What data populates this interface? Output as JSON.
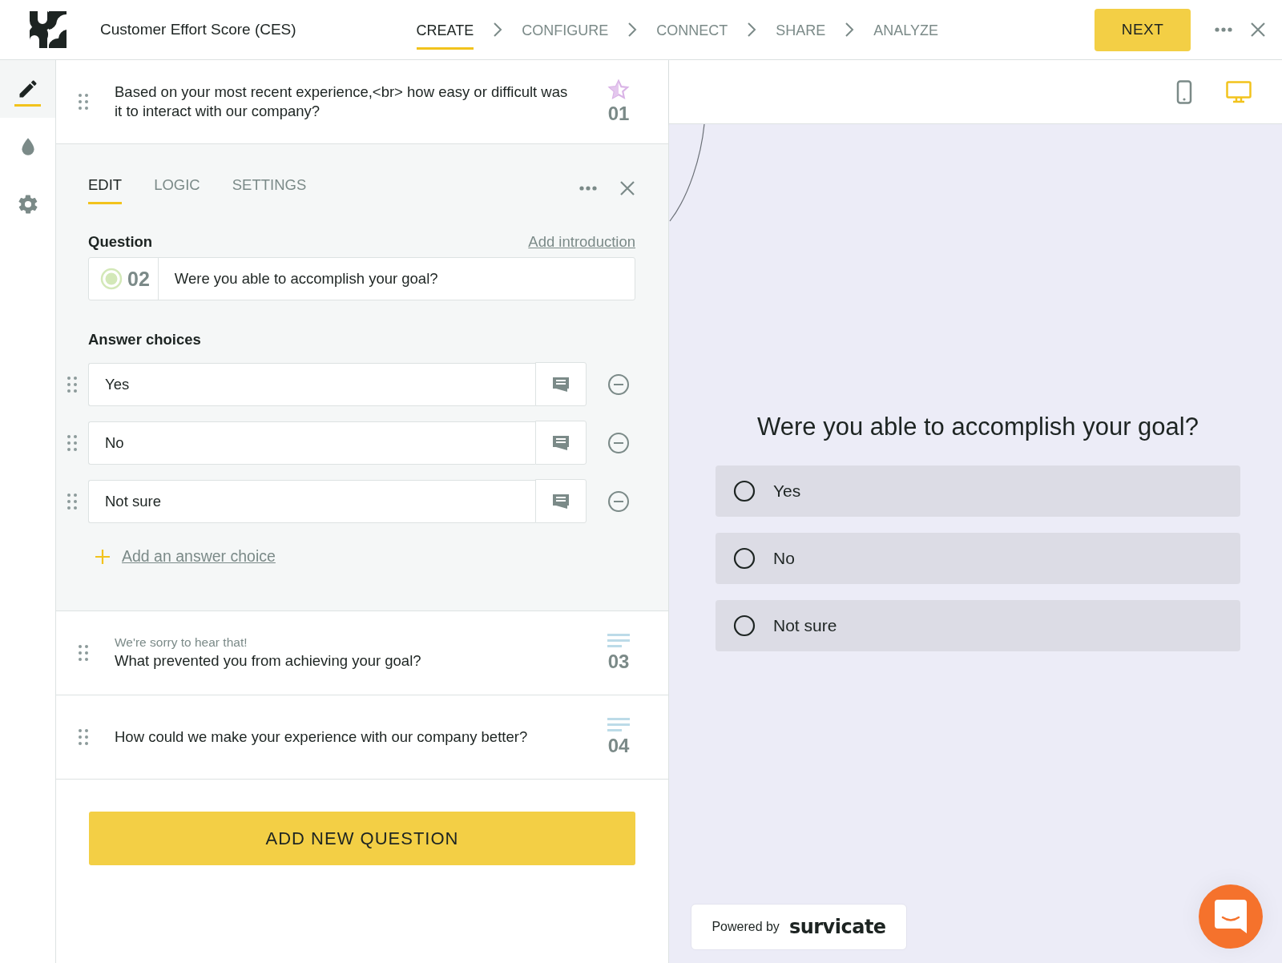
{
  "header": {
    "survey_title": "Customer Effort Score (CES)",
    "steps": [
      {
        "label": "CREATE",
        "selected": true
      },
      {
        "label": "CONFIGURE",
        "selected": false
      },
      {
        "label": "CONNECT",
        "selected": false
      },
      {
        "label": "SHARE",
        "selected": false
      },
      {
        "label": "ANALYZE",
        "selected": false
      }
    ],
    "next_button": "NEXT"
  },
  "sidebar": {
    "items": [
      {
        "kind": "design",
        "selected": true
      },
      {
        "kind": "theme",
        "selected": false
      },
      {
        "kind": "settings",
        "selected": false
      }
    ]
  },
  "questions": [
    {
      "kind": "rating",
      "number": "01",
      "text": "Based on your most recent experience,<br> how easy or difficult was it to interact with our company?",
      "expanded": false
    },
    {
      "kind": "single_choice",
      "number": "02",
      "text": "Were you able to accomplish your goal?",
      "expanded": true
    },
    {
      "kind": "text",
      "number": "03",
      "intro": "We're sorry to hear that!",
      "text": "What prevented you from achieving your goal?",
      "expanded": false
    },
    {
      "kind": "text",
      "number": "04",
      "text": "How could we make your experience with our company better?",
      "expanded": false
    }
  ],
  "editor": {
    "tabs": [
      {
        "label": "EDIT",
        "selected": true
      },
      {
        "label": "LOGIC",
        "selected": false
      },
      {
        "label": "SETTINGS",
        "selected": false
      }
    ],
    "question_label": "Question",
    "add_introduction": "Add introduction",
    "answer_choices_label": "Answer choices",
    "answers": [
      "Yes",
      "No",
      "Not sure"
    ],
    "add_answer": "Add an answer choice"
  },
  "add_question_button": "ADD NEW QUESTION",
  "preview": {
    "devices": [
      {
        "kind": "mobile",
        "selected": false
      },
      {
        "kind": "desktop",
        "selected": true
      }
    ],
    "question": "Were you able to accomplish your goal?",
    "options": [
      "Yes",
      "No",
      "Not sure"
    ],
    "powered_by": "Powered by",
    "brand": "survicate"
  }
}
